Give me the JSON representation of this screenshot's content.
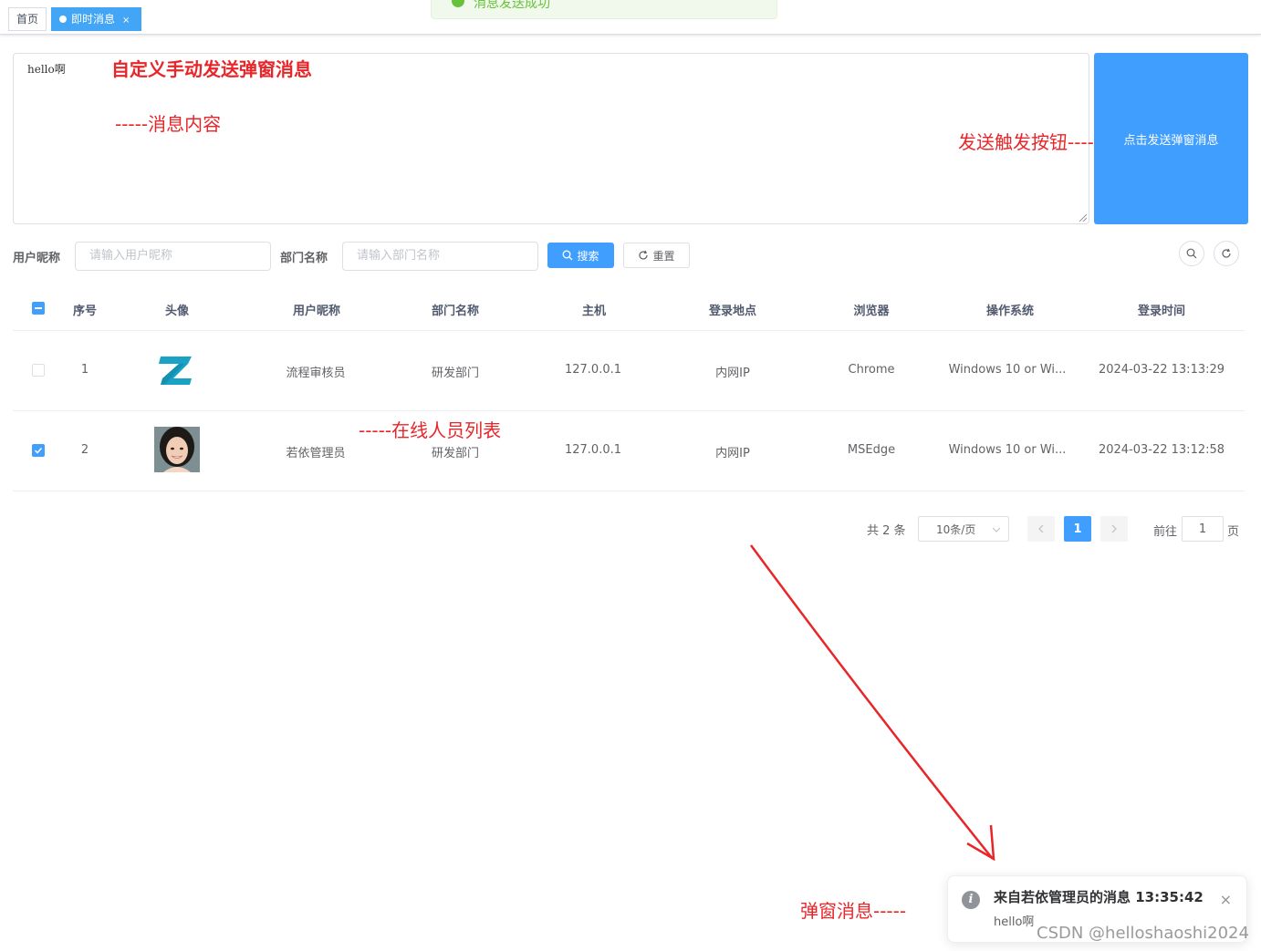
{
  "tabs": [
    {
      "label": "首页",
      "active": false
    },
    {
      "label": "即时消息",
      "active": true,
      "close": "×"
    }
  ],
  "toast": {
    "text": "消息发送成功"
  },
  "message": {
    "value": "hello啊",
    "send_button": "点击发送弹窗消息"
  },
  "search": {
    "user_label": "用户昵称",
    "user_placeholder": "请输入用户昵称",
    "dept_label": "部门名称",
    "dept_placeholder": "请输入部门名称",
    "search_button": "搜索",
    "reset_button": "重置"
  },
  "table": {
    "columns": [
      "序号",
      "头像",
      "用户昵称",
      "部门名称",
      "主机",
      "登录地点",
      "浏览器",
      "操作系统",
      "登录时间"
    ],
    "rows": [
      {
        "checked": false,
        "index": "1",
        "avatar": "logo-z",
        "nickname": "流程审核员",
        "dept": "研发部门",
        "host": "127.0.0.1",
        "location": "内网IP",
        "browser": "Chrome",
        "os": "Windows 10 or Wi...",
        "time": "2024-03-22 13:13:29"
      },
      {
        "checked": true,
        "index": "2",
        "avatar": "portrait",
        "nickname": "若依管理员",
        "dept": "研发部门",
        "host": "127.0.0.1",
        "location": "内网IP",
        "browser": "MSEdge",
        "os": "Windows 10 or Wi...",
        "time": "2024-03-22 13:12:58"
      }
    ]
  },
  "pagination": {
    "total": "共 2 条",
    "page_size": "10条/页",
    "current": "1",
    "goto_label": "前往",
    "goto_value": "1",
    "page_unit": "页"
  },
  "annotations": {
    "title": "自定义手动发送弹窗消息",
    "content": "-----消息内容",
    "button": "发送触发按钮----",
    "list": "-----在线人员列表",
    "popup": "弹窗消息-----"
  },
  "notification": {
    "title": "来自若依管理员的消息 13:35:42",
    "body": "hello啊",
    "close": "×"
  },
  "watermark": "CSDN @helloshaoshi2024",
  "colors": {
    "primary": "#409eff",
    "annotation": "#e8262a",
    "success": "#67c23a"
  }
}
